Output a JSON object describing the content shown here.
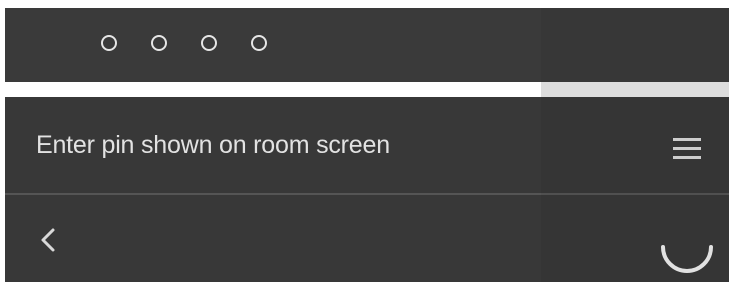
{
  "pin_entry": {
    "total_digits": 4,
    "entered_digits": 0
  },
  "progress": {
    "fraction": 0.74
  },
  "instruction": {
    "text": "Enter pin shown on room screen"
  },
  "icons": {
    "menu": "menu-icon",
    "back": "chevron-left-icon",
    "loading": "loading-spinner-icon"
  },
  "colors": {
    "background": "#3b3b3b",
    "text": "#e2e2e2",
    "icon": "#e6e6e6",
    "progress_fill": "#ffffff",
    "progress_track": "#e9e9e9"
  }
}
